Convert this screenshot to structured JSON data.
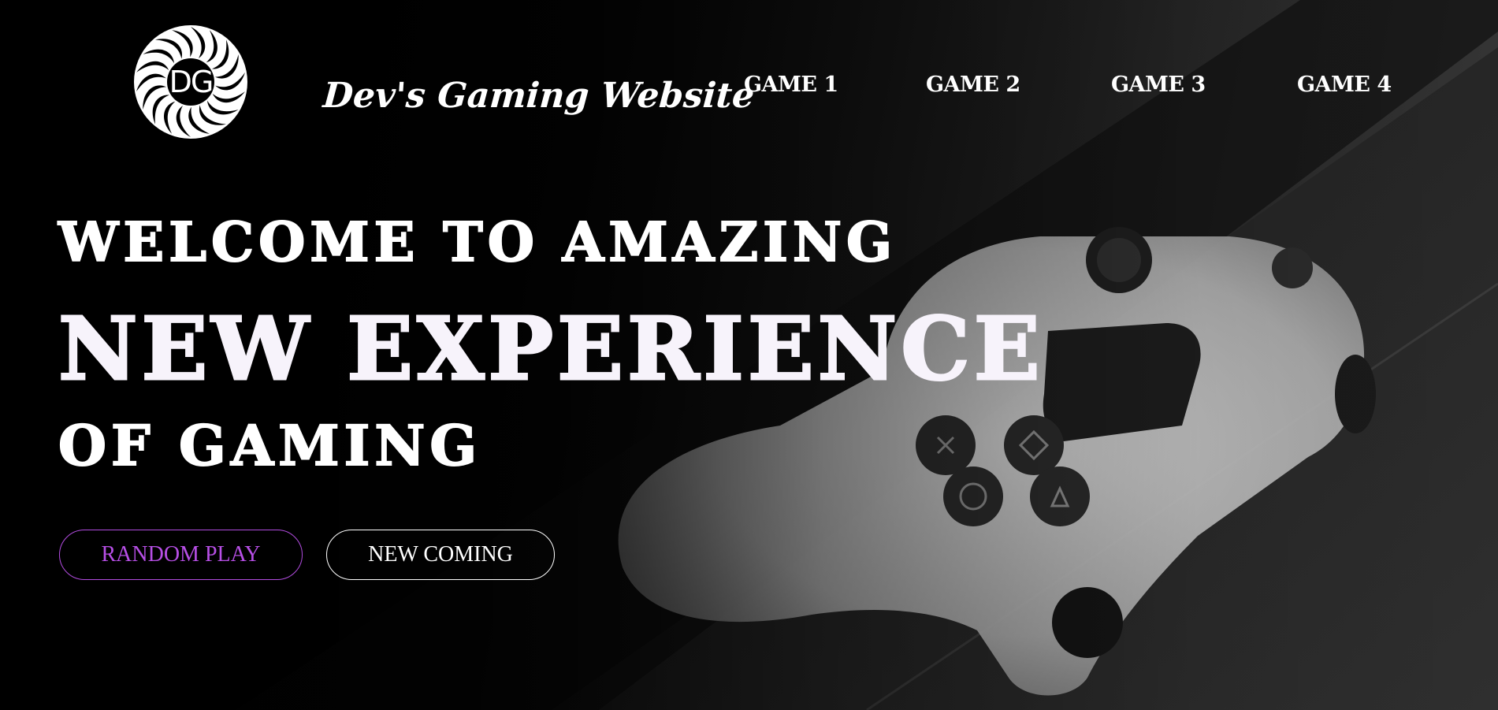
{
  "header": {
    "logo_text": "DG",
    "site_title": "Dev's Gaming Website",
    "nav": [
      {
        "label": "GAME 1"
      },
      {
        "label": "GAME 2"
      },
      {
        "label": "GAME 3"
      },
      {
        "label": "GAME 4"
      }
    ]
  },
  "hero": {
    "line1": "WELCOME TO AMAZING",
    "line2": "NEW EXPERIENCE",
    "line3": "OF GAMING"
  },
  "buttons": {
    "random_play": "RANDOM PLAY",
    "new_coming": "NEW COMING"
  },
  "colors": {
    "accent_purple": "#b74fe6",
    "text": "#ffffff",
    "background": "#000000"
  },
  "icons": {
    "logo": "swirl-logo-icon",
    "background": "game-controller-photo"
  }
}
